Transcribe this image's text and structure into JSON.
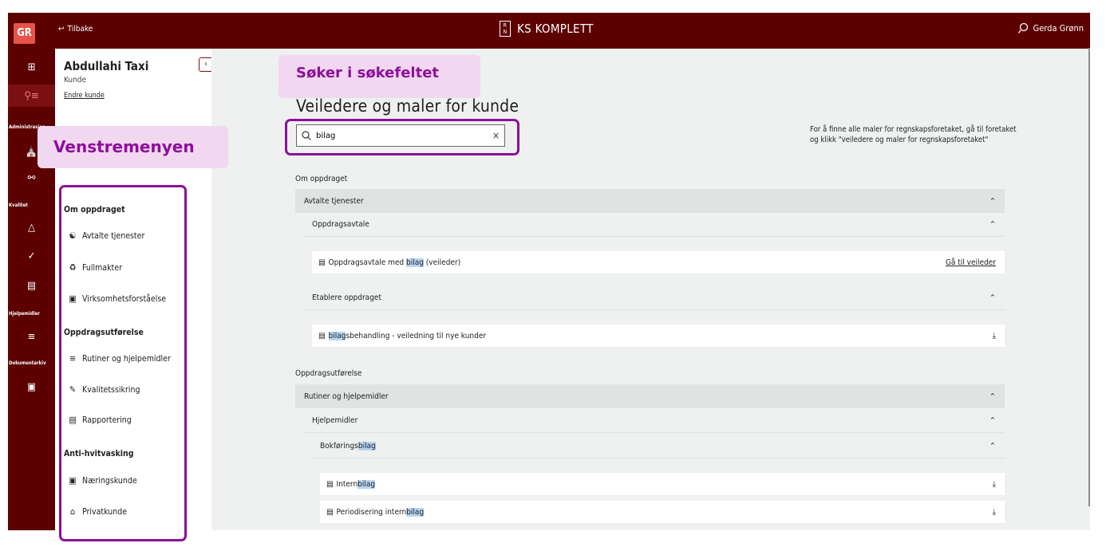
{
  "topbar": {
    "logo": "GR",
    "back_label": "Tilbake",
    "brand_box": "R N",
    "brand": "KS KOMPLETT",
    "user": "Gerda Grønn"
  },
  "rail": {
    "items": [
      "grid-icon",
      "clients-icon",
      "company-icon",
      "network-icon",
      "warning-icon",
      "check-icon",
      "money-icon",
      "list-icon",
      "archive-icon"
    ],
    "labels": [
      "Administrasjon",
      "Kvalitet",
      "Hjelpemidler",
      "Dokumentarkiv"
    ]
  },
  "customer": {
    "name": "Abdullahi Taxi",
    "role": "Kunde",
    "change": "Endre kunde"
  },
  "nav": {
    "sections": [
      {
        "title": "Om oppdraget",
        "items": [
          "Avtalte tjenester",
          "Fullmakter",
          "Virksomhetsforståelse"
        ]
      },
      {
        "title": "Oppdragsutførelse",
        "items": [
          "Rutiner og hjelpemidler",
          "Kvalitetssikring",
          "Rapportering"
        ]
      },
      {
        "title": "Anti-hvitvasking",
        "items": [
          "Næringskunde",
          "Privatkunde"
        ]
      }
    ]
  },
  "main": {
    "title": "Veiledere og maler for kunde",
    "search_value": "bilag",
    "help_text": "For å finne alle maler for regnskapsforetaket, gå til foretaket og klikk \"veiledere og maler for regnskapsforetaket\"",
    "group1": {
      "title": "Om oppdraget",
      "lvl1": "Avtalte tjenester",
      "sub1": "Oppdragsavtale",
      "leaf1_pre": "Oppdragsavtale med ",
      "leaf1_hl": "bilag",
      "leaf1_post": " (veileder)",
      "leaf1_link": "Gå til veileder",
      "sub2": "Etablere oppdraget",
      "leaf2_hl": "bilag",
      "leaf2_post": "sbehandling - veiledning til nye kunder"
    },
    "group2": {
      "title": "Oppdragsutførelse",
      "lvl1": "Rutiner og hjelpemidler",
      "sub1": "Hjelpemidler",
      "sub2_pre": "Bokførings",
      "sub2_hl": "bilag",
      "leaf1_pre": "Intern",
      "leaf1_hl": "bilag",
      "leaf2_pre": "Periodisering intern",
      "leaf2_hl": "bilag"
    }
  },
  "callouts": {
    "search": "Søker i søkefeltet",
    "menu": "Venstremenyen"
  }
}
